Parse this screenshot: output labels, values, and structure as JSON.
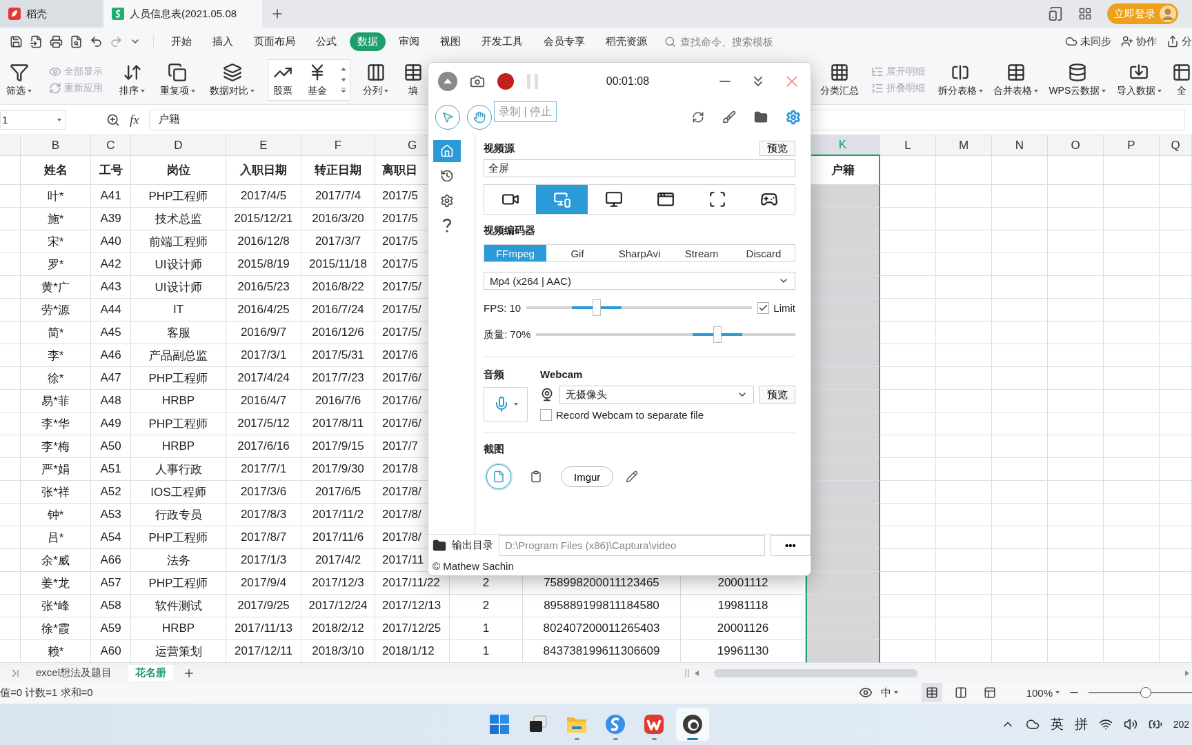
{
  "tab_bar": {
    "tabs": [
      {
        "label": "稻壳",
        "selected": false
      },
      {
        "label": "人员信息表(2021.05.08",
        "selected": true
      }
    ],
    "login": "立即登录"
  },
  "menu_bar": {
    "menus": [
      {
        "label": "开始",
        "selected": false
      },
      {
        "label": "插入",
        "selected": false
      },
      {
        "label": "页面布局",
        "selected": false
      },
      {
        "label": "公式",
        "selected": false
      },
      {
        "label": "数据",
        "selected": true
      },
      {
        "label": "审阅",
        "selected": false
      },
      {
        "label": "视图",
        "selected": false
      },
      {
        "label": "开发工具",
        "selected": false
      },
      {
        "label": "会员专享",
        "selected": false
      },
      {
        "label": "稻壳资源",
        "selected": false
      }
    ],
    "search": {
      "placeholder": "查找命令、搜索模板"
    },
    "actions": [
      "未同步",
      "协作",
      "分"
    ]
  },
  "ribbon": {
    "left": [
      {
        "kind": "button",
        "label": "筛选",
        "dropdown": true
      },
      {
        "kind": "pair",
        "items": [
          {
            "label": "全部显示",
            "disabled": true
          },
          {
            "label": "重新应用",
            "disabled": true
          }
        ]
      },
      {
        "kind": "button",
        "label": "排序",
        "dropdown": true
      },
      {
        "kind": "button",
        "label": "重复项",
        "dropdown": true
      },
      {
        "kind": "button",
        "label": "数据对比",
        "dropdown": true
      },
      {
        "kind": "gallery",
        "items": [
          {
            "label": "股票"
          },
          {
            "label": "基金"
          }
        ]
      },
      {
        "kind": "button",
        "label": "分列",
        "dropdown": true
      },
      {
        "kind": "button",
        "label": "填",
        "dropdown": false
      }
    ],
    "right": [
      {
        "kind": "button",
        "label": "分类汇总",
        "dropdown": false
      },
      {
        "kind": "pair",
        "items": [
          {
            "label": "展开明细",
            "disabled": true
          },
          {
            "label": "折叠明细",
            "disabled": true
          }
        ]
      },
      {
        "kind": "button",
        "label": "拆分表格",
        "dropdown": true
      },
      {
        "kind": "button",
        "label": "合并表格",
        "dropdown": true
      },
      {
        "kind": "button",
        "label": "WPS云数据",
        "dropdown": true
      },
      {
        "kind": "button",
        "label": "导入数据",
        "dropdown": true
      },
      {
        "kind": "button",
        "label": "全",
        "dropdown": false
      }
    ]
  },
  "formula_bar": {
    "cell_ref": "1",
    "fx": "fx",
    "value": "户籍"
  },
  "sheet": {
    "columns": [
      {
        "kind": "column",
        "letter": "B",
        "heading": "姓名",
        "selected": false
      },
      {
        "kind": "column",
        "letter": "C",
        "heading": "工号",
        "selected": false
      },
      {
        "kind": "column",
        "letter": "D",
        "heading": "岗位",
        "selected": false
      },
      {
        "kind": "column",
        "letter": "E",
        "heading": "入职日期",
        "selected": false
      },
      {
        "kind": "column",
        "letter": "F",
        "heading": "转正日期",
        "selected": false
      },
      {
        "kind": "column",
        "letter": "G",
        "heading": "离职日",
        "selected": false
      },
      {
        "kind": "covered"
      },
      {
        "kind": "covered"
      },
      {
        "kind": "covered"
      },
      {
        "kind": "column",
        "letter": "K",
        "heading": "户籍",
        "selected": true
      },
      {
        "kind": "column",
        "letter": "L",
        "selected": false
      },
      {
        "kind": "column",
        "letter": "M",
        "selected": false
      },
      {
        "kind": "column",
        "letter": "N",
        "selected": false
      },
      {
        "kind": "column",
        "letter": "O",
        "selected": false
      },
      {
        "kind": "column",
        "letter": "P",
        "selected": false
      },
      {
        "kind": "column",
        "letter": "Q",
        "selected": false
      }
    ],
    "rows": [
      {
        "cells": [
          "叶*",
          "A41",
          "PHP工程师",
          "2017/4/5",
          "2017/7/4",
          "2017/5"
        ]
      },
      {
        "cells": [
          "施*",
          "A39",
          "技术总监",
          "2015/12/21",
          "2016/3/20",
          "2017/5"
        ]
      },
      {
        "cells": [
          "宋*",
          "A40",
          "前端工程师",
          "2016/12/8",
          "2017/3/7",
          "2017/5"
        ]
      },
      {
        "cells": [
          "罗*",
          "A42",
          "UI设计师",
          "2015/8/19",
          "2015/11/18",
          "2017/5"
        ]
      },
      {
        "cells": [
          "黄*广",
          "A43",
          "UI设计师",
          "2016/5/23",
          "2016/8/22",
          "2017/5/"
        ]
      },
      {
        "cells": [
          "劳*源",
          "A44",
          "IT",
          "2016/4/25",
          "2016/7/24",
          "2017/5/"
        ]
      },
      {
        "cells": [
          "简*",
          "A45",
          "客服",
          "2016/9/7",
          "2016/12/6",
          "2017/5/"
        ]
      },
      {
        "cells": [
          "李*",
          "A46",
          "产品副总监",
          "2017/3/1",
          "2017/5/31",
          "2017/6"
        ]
      },
      {
        "cells": [
          "徐*",
          "A47",
          "PHP工程师",
          "2017/4/24",
          "2017/7/23",
          "2017/6/"
        ]
      },
      {
        "cells": [
          "易*菲",
          "A48",
          "HRBP",
          "2016/4/7",
          "2016/7/6",
          "2017/6/"
        ]
      },
      {
        "cells": [
          "李*华",
          "A49",
          "PHP工程师",
          "2017/5/12",
          "2017/8/11",
          "2017/6/"
        ]
      },
      {
        "cells": [
          "李*梅",
          "A50",
          "HRBP",
          "2017/6/16",
          "2017/9/15",
          "2017/7"
        ]
      },
      {
        "cells": [
          "严*娟",
          "A51",
          "人事行政",
          "2017/7/1",
          "2017/9/30",
          "2017/8"
        ]
      },
      {
        "cells": [
          "张*祥",
          "A52",
          "IOS工程师",
          "2017/3/6",
          "2017/6/5",
          "2017/8/"
        ]
      },
      {
        "cells": [
          "钟*",
          "A53",
          "行政专员",
          "2017/8/3",
          "2017/11/2",
          "2017/8/"
        ]
      },
      {
        "cells": [
          "吕*",
          "A54",
          "PHP工程师",
          "2017/8/7",
          "2017/11/6",
          "2017/8/"
        ]
      },
      {
        "cells": [
          "余*威",
          "A66",
          "法务",
          "2017/1/3",
          "2017/4/2",
          "2017/11"
        ]
      },
      {
        "cells": [
          "姜*龙",
          "A57",
          "PHP工程师",
          "2017/9/4",
          "2017/12/3",
          "2017/11/22",
          "2",
          "758998200011123465",
          "20001112"
        ]
      },
      {
        "cells": [
          "张*峰",
          "A58",
          "软件测试",
          "2017/9/25",
          "2017/12/24",
          "2017/12/13",
          "2",
          "895889199811184580",
          "19981118"
        ]
      },
      {
        "cells": [
          "徐*霞",
          "A59",
          "HRBP",
          "2017/11/13",
          "2018/2/12",
          "2017/12/25",
          "1",
          "802407200011265403",
          "20001126"
        ]
      },
      {
        "cells": [
          "赖*",
          "A60",
          "运营策划",
          "2017/12/11",
          "2018/3/10",
          "2018/1/12",
          "1",
          "843738199611306609",
          "19961130"
        ]
      }
    ]
  },
  "sheet_tabs": [
    {
      "label": "excel想法及题目",
      "selected": false
    },
    {
      "label": "花名册",
      "selected": true
    }
  ],
  "status_bar": {
    "summary": "值=0 计数=1 求和=0",
    "input_mode": "中",
    "views": [
      {
        "selected": true
      },
      {
        "selected": false
      },
      {
        "selected": false
      }
    ],
    "zoom": "100%",
    "zoom_slider": {
      "level": 0.55
    }
  },
  "taskbar": {
    "apps": [
      {
        "running": false,
        "selected": false
      },
      {
        "running": false,
        "selected": false
      },
      {
        "running": true,
        "selected": false
      },
      {
        "running": true,
        "selected": false
      },
      {
        "running": true,
        "selected": false
      },
      {
        "running": true,
        "selected": true
      }
    ],
    "tray": [
      "英",
      "拼"
    ],
    "clock": "202"
  },
  "recorder": {
    "timer": "00:01:08",
    "tooltip": "录制 | 停止",
    "nav": [
      {
        "selected": true
      },
      {
        "selected": false
      },
      {
        "selected": false
      },
      {
        "selected": false
      }
    ],
    "video_source": {
      "title": "视频源",
      "preview": "预览",
      "value": "全屏",
      "sources": [
        {
          "selected": false
        },
        {
          "selected": true
        },
        {
          "selected": false
        },
        {
          "selected": false
        },
        {
          "selected": false
        },
        {
          "selected": false
        }
      ]
    },
    "encoder": {
      "title": "视频编码器",
      "tabs": [
        {
          "label": "FFmpeg",
          "selected": true
        },
        {
          "label": "Gif",
          "selected": false
        },
        {
          "label": "SharpAvi",
          "selected": false
        },
        {
          "label": "Stream",
          "selected": false
        },
        {
          "label": "Discard",
          "selected": false
        }
      ],
      "format": "Mp4 (x264 | AAC)"
    },
    "fps": {
      "label": "FPS:",
      "value": "10",
      "level": 0.31,
      "limit": {
        "label": "Limit",
        "checked": true
      }
    },
    "quality": {
      "label": "质量:",
      "value": "70%",
      "level": 0.7
    },
    "audio": {
      "title": "音频"
    },
    "webcam": {
      "title": "Webcam",
      "value": "无摄像头",
      "preview": "预览",
      "separate": {
        "label": "Record Webcam to separate file",
        "checked": false
      }
    },
    "screenshot": {
      "title": "截图",
      "targets": [
        {
          "kind": "file",
          "selected": true
        },
        {
          "kind": "clipboard",
          "selected": false
        },
        {
          "kind": "imgur",
          "label": "Imgur"
        },
        {
          "kind": "editor"
        }
      ]
    },
    "output": {
      "label": "输出目录",
      "path": "D:\\Program Files (x86)\\Captura\\video",
      "more": "•••"
    },
    "copyright": "© Mathew Sachin"
  }
}
